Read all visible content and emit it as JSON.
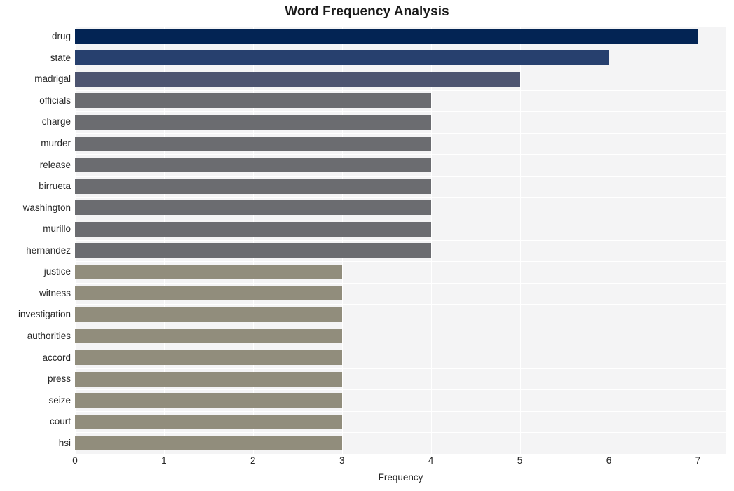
{
  "chart_data": {
    "type": "bar",
    "orientation": "horizontal",
    "title": "Word Frequency Analysis",
    "xlabel": "Frequency",
    "ylabel": "",
    "xlim": [
      0,
      7.32
    ],
    "xticks": [
      0,
      1,
      2,
      3,
      4,
      5,
      6,
      7
    ],
    "xticklabels": [
      "0",
      "1",
      "2",
      "3",
      "4",
      "5",
      "6",
      "7"
    ],
    "grid": true,
    "legend": null,
    "categories": [
      "drug",
      "state",
      "madrigal",
      "officials",
      "charge",
      "murder",
      "release",
      "birrueta",
      "washington",
      "murillo",
      "hernandez",
      "justice",
      "witness",
      "investigation",
      "authorities",
      "accord",
      "press",
      "seize",
      "court",
      "hsi"
    ],
    "values": [
      7,
      6,
      5,
      4,
      4,
      4,
      4,
      4,
      4,
      4,
      4,
      3,
      3,
      3,
      3,
      3,
      3,
      3,
      3,
      3
    ],
    "bar_colors": [
      "#032454",
      "#27406e",
      "#4d5470",
      "#6b6c70",
      "#6b6c70",
      "#6b6c70",
      "#6b6c70",
      "#6b6c70",
      "#6b6c70",
      "#6b6c70",
      "#6b6c70",
      "#918d7c",
      "#918d7c",
      "#918d7c",
      "#918d7c",
      "#918d7c",
      "#918d7c",
      "#918d7c",
      "#918d7c",
      "#918d7c"
    ],
    "plot_background": "#f4f4f5",
    "grid_color": "#ffffff",
    "figure_background": "#ffffff",
    "text_color": "#262626"
  }
}
